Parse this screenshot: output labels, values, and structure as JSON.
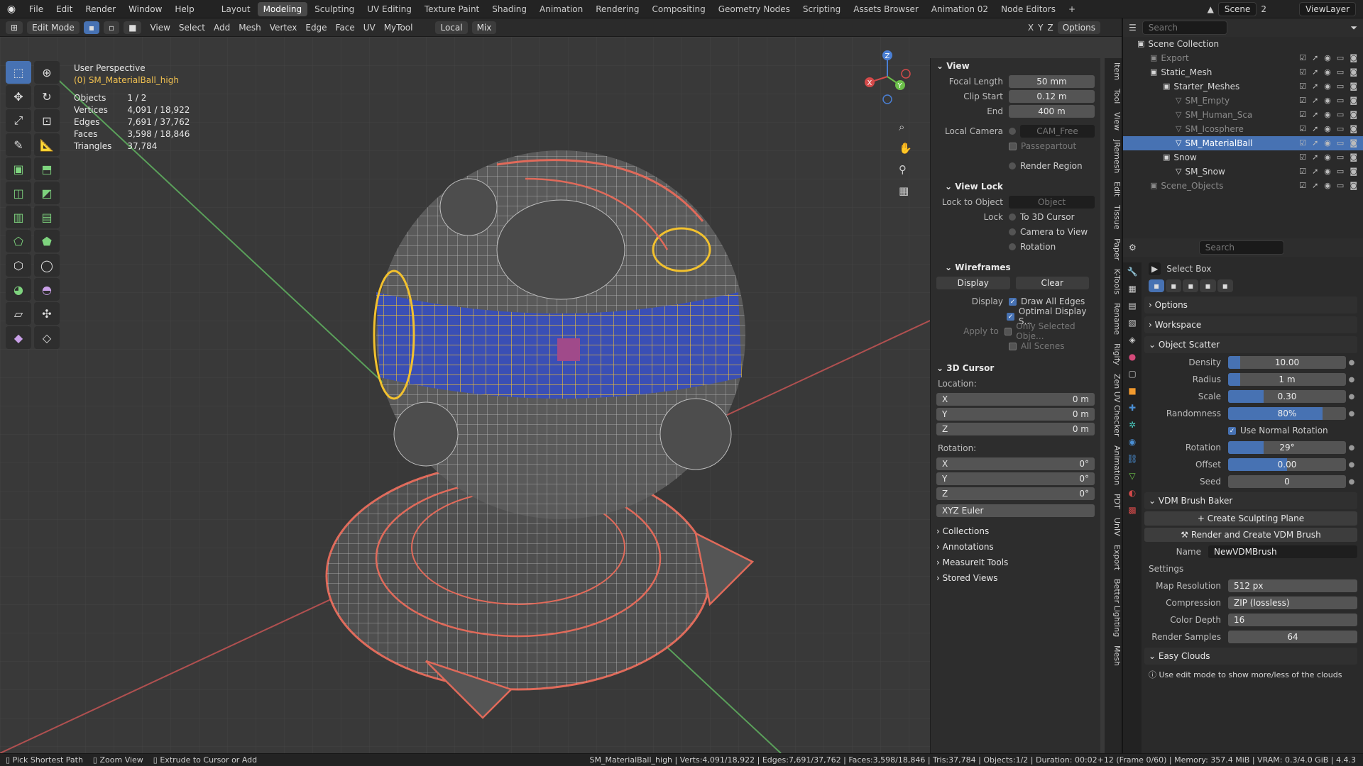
{
  "menu": [
    "File",
    "Edit",
    "Render",
    "Window",
    "Help"
  ],
  "workspaces": [
    "Layout",
    "Modeling",
    "Sculpting",
    "UV Editing",
    "Texture Paint",
    "Shading",
    "Animation",
    "Rendering",
    "Compositing",
    "Geometry Nodes",
    "Scripting",
    "Assets Browser",
    "Animation 02",
    "Node Editors"
  ],
  "active_workspace": "Modeling",
  "scene": {
    "name": "Scene",
    "count": "2",
    "view_layer": "ViewLayer"
  },
  "header": {
    "mode": "Edit Mode",
    "menus": [
      "View",
      "Select",
      "Add",
      "Mesh",
      "Vertex",
      "Edge",
      "Face",
      "UV",
      "MyTool"
    ],
    "orientation": "Local",
    "pivot": "Mix",
    "axes": [
      "X",
      "Y",
      "Z"
    ],
    "options": "Options"
  },
  "viewport": {
    "perspective": "User Perspective",
    "object": "(0) SM_MaterialBall_high",
    "stats": [
      {
        "label": "Objects",
        "value": "1 / 2"
      },
      {
        "label": "Vertices",
        "value": "4,091 / 18,922"
      },
      {
        "label": "Edges",
        "value": "7,691 / 37,762"
      },
      {
        "label": "Faces",
        "value": "3,598 / 18,846"
      },
      {
        "label": "Triangles",
        "value": "37,784"
      }
    ]
  },
  "npanel": {
    "view_title": "View",
    "focal_length": {
      "label": "Focal Length",
      "value": "50 mm"
    },
    "clip_start": {
      "label": "Clip Start",
      "value": "0.12 m"
    },
    "clip_end": {
      "label": "End",
      "value": "400 m"
    },
    "local_camera": {
      "label": "Local Camera",
      "value": "CAM_Free"
    },
    "passepartout": "Passepartout",
    "render_region": "Render Region",
    "view_lock": "View Lock",
    "lock_to_object": {
      "label": "Lock to Object",
      "placeholder": "Object"
    },
    "lock_label": "Lock",
    "lock_opts": [
      "To 3D Cursor",
      "Camera to View",
      "Rotation"
    ],
    "wireframes": "Wireframes",
    "wf_display": "Display",
    "wf_clear": "Clear",
    "display_label": "Display",
    "draw_all_edges": "Draw All Edges",
    "optimal_display": "Optimal Display S...",
    "apply_to": "Apply to",
    "only_selected": "Only Selected Obje...",
    "all_scenes": "All Scenes",
    "cursor_title": "3D Cursor",
    "location": "Location:",
    "loc": [
      {
        "axis": "X",
        "value": "0 m"
      },
      {
        "axis": "Y",
        "value": "0 m"
      },
      {
        "axis": "Z",
        "value": "0 m"
      }
    ],
    "rotation": "Rotation:",
    "rot": [
      {
        "axis": "X",
        "value": "0°"
      },
      {
        "axis": "Y",
        "value": "0°"
      },
      {
        "axis": "Z",
        "value": "0°"
      }
    ],
    "rot_mode": "XYZ Euler",
    "collapsed": [
      "Collections",
      "Annotations",
      "MeasureIt Tools",
      "Stored Views"
    ],
    "vtabs": [
      "Item",
      "Tool",
      "View",
      "JRemesh",
      "Edit",
      "Tissue",
      "Paper",
      "K-Tools",
      "Rename",
      "Rigify",
      "Zen UV Checker",
      "Animation",
      "PDT",
      "UnIV",
      "Export",
      "Better Lighting",
      "Mesh"
    ]
  },
  "outliner": {
    "search_placeholder": "Search",
    "root": "Scene Collection",
    "items": [
      {
        "name": "Export",
        "indent": 1,
        "icon": "▣",
        "dim": true
      },
      {
        "name": "Static_Mesh",
        "indent": 1,
        "icon": "▣"
      },
      {
        "name": "Starter_Meshes",
        "indent": 2,
        "icon": "▣"
      },
      {
        "name": "SM_Empty",
        "indent": 3,
        "icon": "▽",
        "dim": true
      },
      {
        "name": "SM_Human_Sca",
        "indent": 3,
        "icon": "▽",
        "dim": true
      },
      {
        "name": "SM_Icosphere",
        "indent": 3,
        "icon": "▽",
        "dim": true
      },
      {
        "name": "SM_MaterialBall",
        "indent": 3,
        "icon": "▽",
        "sel": true
      },
      {
        "name": "Snow",
        "indent": 2,
        "icon": "▣"
      },
      {
        "name": "SM_Snow",
        "indent": 3,
        "icon": "▽"
      },
      {
        "name": "Scene_Objects",
        "indent": 1,
        "icon": "▣",
        "dim": true
      }
    ]
  },
  "properties": {
    "search_placeholder": "Search",
    "tool": "Select Box",
    "options": "Options",
    "workspace": "Workspace",
    "scatter_title": "Object Scatter",
    "scatter": [
      {
        "label": "Density",
        "value": "10.00",
        "fill": 0.1
      },
      {
        "label": "Radius",
        "value": "1 m",
        "fill": 0.1
      },
      {
        "label": "Scale",
        "value": "0.30",
        "fill": 0.3
      },
      {
        "label": "Randomness",
        "value": "80%",
        "fill": 0.8
      }
    ],
    "use_normal_rotation": "Use Normal Rotation",
    "scatter2": [
      {
        "label": "Rotation",
        "value": "29°",
        "fill": 0.3
      },
      {
        "label": "Offset",
        "value": "0.00",
        "fill": 0.5
      },
      {
        "label": "Seed",
        "value": "0",
        "fill": 0
      }
    ],
    "vdm_title": "VDM Brush Baker",
    "create_plane": "Create Sculpting Plane",
    "render_create": "Render and Create VDM Brush",
    "name_label": "Name",
    "name_value": "NewVDMBrush",
    "settings": "Settings",
    "vdm_settings": [
      {
        "label": "Map Resolution",
        "value": "512 px"
      },
      {
        "label": "Compression",
        "value": "ZIP (lossless)"
      },
      {
        "label": "Color Depth",
        "value": "16"
      },
      {
        "label": "Render Samples",
        "value": "64"
      }
    ],
    "clouds_title": "Easy Clouds",
    "clouds_hint": "Use edit mode to show more/less of the clouds"
  },
  "status": {
    "left": [
      "Pick Shortest Path",
      "Zoom View",
      "Extrude to Cursor or Add"
    ],
    "right": "SM_MaterialBall_high | Verts:4,091/18,922 | Edges:7,691/37,762 | Faces:3,598/18,846 | Tris:37,784 | Objects:1/2 | Duration: 00:02+12 (Frame 0/60) | Memory: 357.4 MiB | VRAM: 0.3/4.0 GiB | 4.4.3"
  }
}
